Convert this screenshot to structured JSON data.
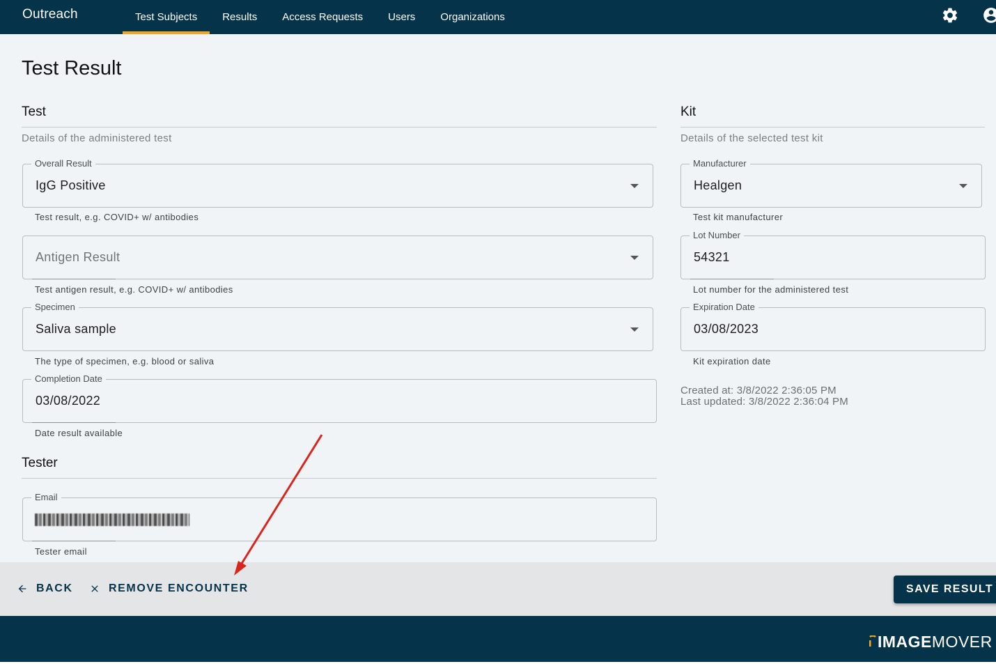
{
  "app": {
    "brand": "Outreach"
  },
  "nav": {
    "items": [
      {
        "label": "Test Subjects",
        "active": true
      },
      {
        "label": "Results"
      },
      {
        "label": "Access Requests"
      },
      {
        "label": "Users"
      },
      {
        "label": "Organizations"
      }
    ]
  },
  "page": {
    "title": "Test Result"
  },
  "test": {
    "title": "Test",
    "description": "Details of the administered test",
    "overall_result": {
      "label": "Overall Result",
      "value": "IgG Positive",
      "helper": "Test result, e.g. COVID+ w/ antibodies"
    },
    "antigen_result": {
      "placeholder": "Antigen Result",
      "helper": "Test antigen result, e.g. COVID+ w/ antibodies"
    },
    "specimen": {
      "label": "Specimen",
      "value": "Saliva sample",
      "helper": "The type of specimen, e.g. blood or saliva"
    },
    "completion_date": {
      "label": "Completion Date",
      "value": "03/08/2022",
      "helper": "Date result available"
    }
  },
  "tester": {
    "title": "Tester",
    "email": {
      "label": "Email",
      "helper": "Tester email"
    }
  },
  "kit": {
    "title": "Kit",
    "description": "Details of the selected test kit",
    "manufacturer": {
      "label": "Manufacturer",
      "value": "Healgen",
      "helper": "Test kit manufacturer"
    },
    "lot_number": {
      "label": "Lot Number",
      "value": "54321",
      "helper": "Lot number for the administered test"
    },
    "expiration_date": {
      "label": "Expiration Date",
      "value": "03/08/2023",
      "helper": "Kit expiration date"
    },
    "created_at": "Created at: 3/8/2022 2:36:05 PM",
    "last_updated": "Last updated: 3/8/2022 2:36:04 PM"
  },
  "actions": {
    "back_label": "BACK",
    "remove_label": "REMOVE ENCOUNTER",
    "save_label": "SAVE RESULT"
  },
  "footer": {
    "logo_image": "IMAGE",
    "logo_mover": "MOVER"
  },
  "colors": {
    "primary": "#05334a",
    "accent": "#f5a623",
    "background": "#f1f4f7",
    "annotation_arrow": "#d9261c"
  },
  "icons": {
    "settings": "gear-icon",
    "account": "account-icon",
    "back": "arrow-left-icon",
    "remove": "close-icon"
  }
}
